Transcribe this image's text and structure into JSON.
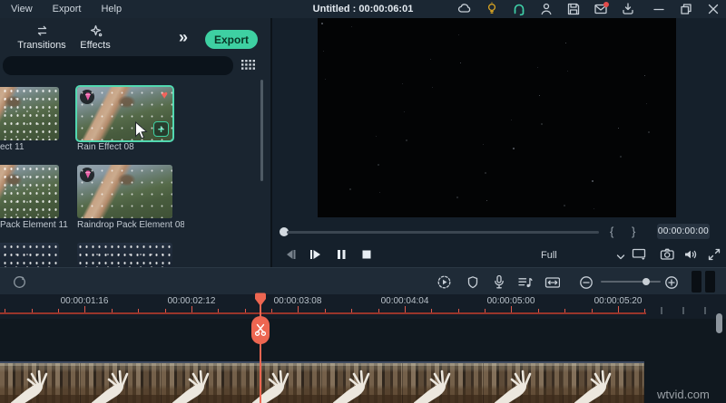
{
  "titlebar": {
    "menus": [
      "View",
      "Export",
      "Help"
    ],
    "title": "Untitled : 00:00:06:01",
    "icons": [
      "cloud",
      "lightbulb",
      "headset",
      "user",
      "save",
      "mail-notification",
      "download",
      "minimize",
      "restore",
      "close"
    ]
  },
  "left_panel": {
    "tabs": [
      {
        "label": "Transitions"
      },
      {
        "label": "Effects"
      }
    ],
    "more_tabs": "»",
    "export_button": "Export",
    "search": {
      "placeholder": ""
    },
    "thumbnails": [
      {
        "label": "ect 11",
        "selected": false
      },
      {
        "label": "Rain Effect 08",
        "selected": true,
        "premium": true,
        "favorited": true,
        "addable": true
      },
      {
        "label": "Pack Element 11",
        "selected": false
      },
      {
        "label": "Raindrop Pack Element 08",
        "selected": false,
        "premium": true
      }
    ]
  },
  "preview": {
    "timecode": "00:00:00:00",
    "mark_in": "{",
    "mark_out": "}",
    "zoom_level": "Full"
  },
  "timeline": {
    "ruler_labels": [
      "00:00:01:16",
      "00:00:02:12",
      "00:00:03:08",
      "00:00:04:04",
      "00:00:05:00",
      "00:00:05:20"
    ]
  },
  "watermark": "wtvid.com",
  "colors": {
    "accent_teal": "#3ed0a2",
    "selection_border": "#52d8b0",
    "playhead_coral": "#ed6651",
    "ruler_red": "#99352b",
    "notification_red": "#e14b4b",
    "bulb_gold": "#d9a422",
    "gem_pink": "#ea5fa6"
  }
}
